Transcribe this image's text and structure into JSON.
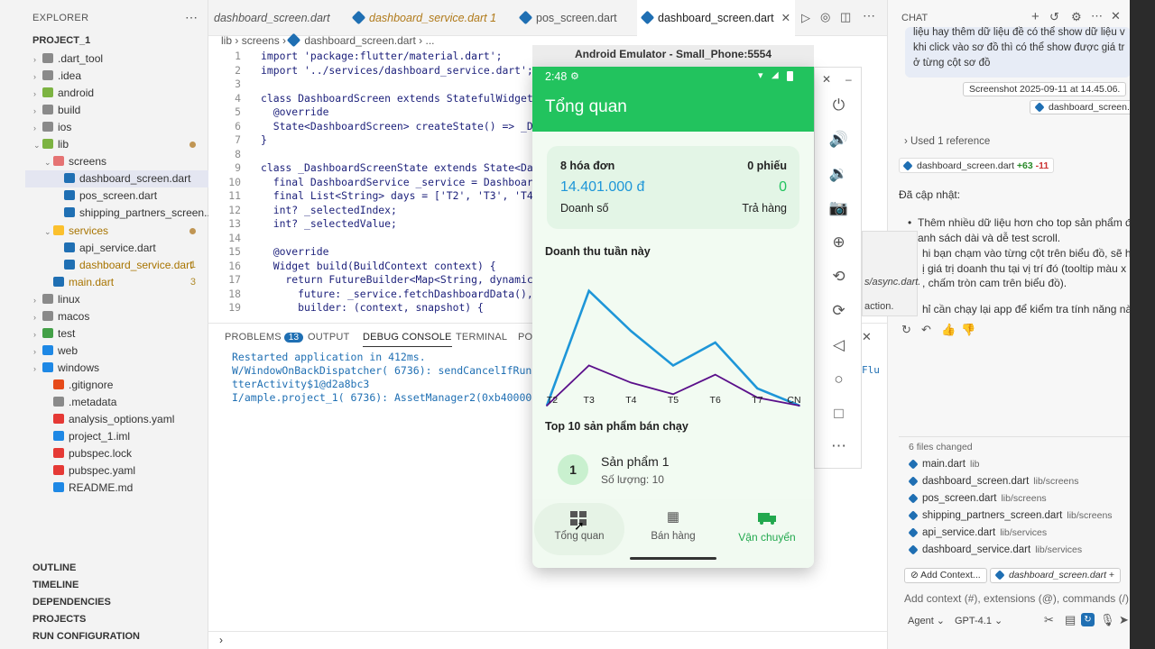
{
  "explorer": {
    "title": "EXPLORER",
    "project": "PROJECT_1",
    "items": [
      {
        "label": ".dart_tool"
      },
      {
        "label": ".idea"
      },
      {
        "label": "android"
      },
      {
        "label": "build"
      },
      {
        "label": "ios"
      },
      {
        "label": "lib"
      },
      {
        "label": "screens"
      },
      {
        "label": "dashboard_screen.dart"
      },
      {
        "label": "pos_screen.dart"
      },
      {
        "label": "shipping_partners_screen..."
      },
      {
        "label": "services"
      },
      {
        "label": "api_service.dart"
      },
      {
        "label": "dashboard_service.dart",
        "badge": "1"
      },
      {
        "label": "main.dart",
        "badge": "3"
      },
      {
        "label": "linux"
      },
      {
        "label": "macos"
      },
      {
        "label": "test"
      },
      {
        "label": "web"
      },
      {
        "label": "windows"
      },
      {
        "label": ".gitignore"
      },
      {
        "label": ".metadata"
      },
      {
        "label": "analysis_options.yaml"
      },
      {
        "label": "project_1.iml"
      },
      {
        "label": "pubspec.lock"
      },
      {
        "label": "pubspec.yaml"
      },
      {
        "label": "README.md"
      }
    ],
    "sections": [
      "OUTLINE",
      "TIMELINE",
      "DEPENDENCIES",
      "PROJECTS",
      "RUN CONFIGURATION"
    ]
  },
  "tabs": [
    {
      "label": "dashboard_screen.dart"
    },
    {
      "label": "dashboard_service.dart 1"
    },
    {
      "label": "pos_screen.dart"
    },
    {
      "label": "dashboard_screen.dart"
    }
  ],
  "breadcrumb": {
    "a": "lib",
    "b": "screens",
    "c": "dashboard_screen.dart",
    "d": "..."
  },
  "code": [
    {
      "n": "1",
      "t": "import 'package:flutter/material.dart';"
    },
    {
      "n": "2",
      "t": "import '../services/dashboard_service.dart';"
    },
    {
      "n": "3",
      "t": ""
    },
    {
      "n": "4",
      "t": "class DashboardScreen extends StatefulWidget {"
    },
    {
      "n": "5",
      "t": "  @override"
    },
    {
      "n": "6",
      "t": "  State<DashboardScreen> createState() => _Dashb"
    },
    {
      "n": "7",
      "t": "}"
    },
    {
      "n": "8",
      "t": ""
    },
    {
      "n": "9",
      "t": "class _DashboardScreenState extends State<Dashbo"
    },
    {
      "n": "10",
      "t": "  final DashboardService _service = DashboardSer"
    },
    {
      "n": "11",
      "t": "  final List<String> days = ['T2', 'T3', 'T4', '"
    },
    {
      "n": "12",
      "t": "  int? _selectedIndex;"
    },
    {
      "n": "13",
      "t": "  int? _selectedValue;"
    },
    {
      "n": "14",
      "t": ""
    },
    {
      "n": "15",
      "t": "  @override"
    },
    {
      "n": "16",
      "t": "  Widget build(BuildContext context) {"
    },
    {
      "n": "17",
      "t": "    return FutureBuilder<Map<String, dynamic>>("
    },
    {
      "n": "18",
      "t": "      future: _service.fetchDashboardData(),"
    },
    {
      "n": "19",
      "t": "      builder: (context, snapshot) {"
    }
  ],
  "panel": {
    "tabs": [
      "PROBLEMS",
      "OUTPUT",
      "DEBUG CONSOLE",
      "TERMINAL",
      "PO"
    ],
    "problems_count": "13",
    "console": [
      "Restarted application in 412ms.",
      "W/WindowOnBackDispatcher( 6736): sendCancelIfRunning:",
      "tterActivity$1@d2a8bc3",
      "I/ample.project_1( 6736): AssetManager2(0xb4000075c83"
    ],
    "overflow_right": "Flu"
  },
  "emulator": {
    "title": "Android Emulator - Small_Phone:5554",
    "time": "2:48",
    "app_title": "Tổng quan",
    "card": {
      "invoices": "8 hóa đơn",
      "tickets": "0 phiếu",
      "revenue": "14.401.000 đ",
      "returns_value": "0",
      "revenue_label": "Doanh số",
      "returns_label": "Trả hàng"
    },
    "chart_title": "Doanh thu tuần này",
    "top_title": "Top 10 sản phẩm bán chạy",
    "product": {
      "rank": "1",
      "name": "Sản phẩm 1",
      "qty": "Số lượng: 10"
    },
    "nav": [
      {
        "label": "Tổng quan",
        "icon": "dashboard-icon"
      },
      {
        "label": "Bán hàng",
        "icon": "cash-register-icon"
      },
      {
        "label": "Vận chuyển",
        "icon": "truck-icon"
      }
    ],
    "colors": {
      "primary": "#22c35e",
      "revenue": "#1e96d8",
      "secondary": "#5a0f8a"
    }
  },
  "chart_data": {
    "type": "line",
    "title": "Doanh thu tuần này",
    "categories": [
      "T2",
      "T3",
      "T4",
      "T5",
      "T6",
      "T7",
      "CN"
    ],
    "series": [
      {
        "values": [
          0,
          100,
          65,
          35,
          55,
          15,
          0
        ]
      },
      {
        "values": [
          0,
          35,
          20,
          10,
          27,
          7,
          0
        ]
      }
    ],
    "ylim": [
      0,
      110
    ],
    "grid": false
  },
  "chat": {
    "title": "CHAT",
    "user_msg": [
      "liệu hay thêm dữ liệu đề có thể show dữ liệu v",
      "khi click vào sơ đồ thì có thể show được giá tr",
      "ở từng cột sơ đồ"
    ],
    "screenshot_chip": "Screenshot 2025-09-11 at 14.45.06.",
    "file_chip": "dashboard_screen.d",
    "used_ref": "Used 1 reference",
    "ref_file": "dashboard_screen.dart",
    "ref_add": "+63",
    "ref_del": "-11",
    "updated": "Đã cập nhật:",
    "bullets": [
      "Thêm nhiều dữ liệu hơn cho top sản phẩm để",
      "anh sách dài và dễ test scroll.",
      "hi bạn chạm vào từng cột trên biểu đồ, sẽ h",
      "ị giá trị doanh thu tại vị trí đó (tooltip màu x",
      ", chấm tròn cam trên biểu đồ).",
      "hỉ cần chạy lại app để kiểm tra tính năng nà"
    ],
    "overlay_a": "s/async.dart.",
    "overlay_b": "action.",
    "files_changed": "6 files changed",
    "files": [
      {
        "name": "main.dart",
        "path": "lib"
      },
      {
        "name": "dashboard_screen.dart",
        "path": "lib/screens"
      },
      {
        "name": "pos_screen.dart",
        "path": "lib/screens"
      },
      {
        "name": "shipping_partners_screen.dart",
        "path": "lib/screens"
      },
      {
        "name": "api_service.dart",
        "path": "lib/services"
      },
      {
        "name": "dashboard_service.dart",
        "path": "lib/services"
      }
    ],
    "add_context": "Add Context...",
    "context_file": "dashboard_screen.dart",
    "input_placeholder": "Add context (#), extensions (@), commands (/)",
    "mode": "Agent",
    "model": "GPT-4.1"
  }
}
